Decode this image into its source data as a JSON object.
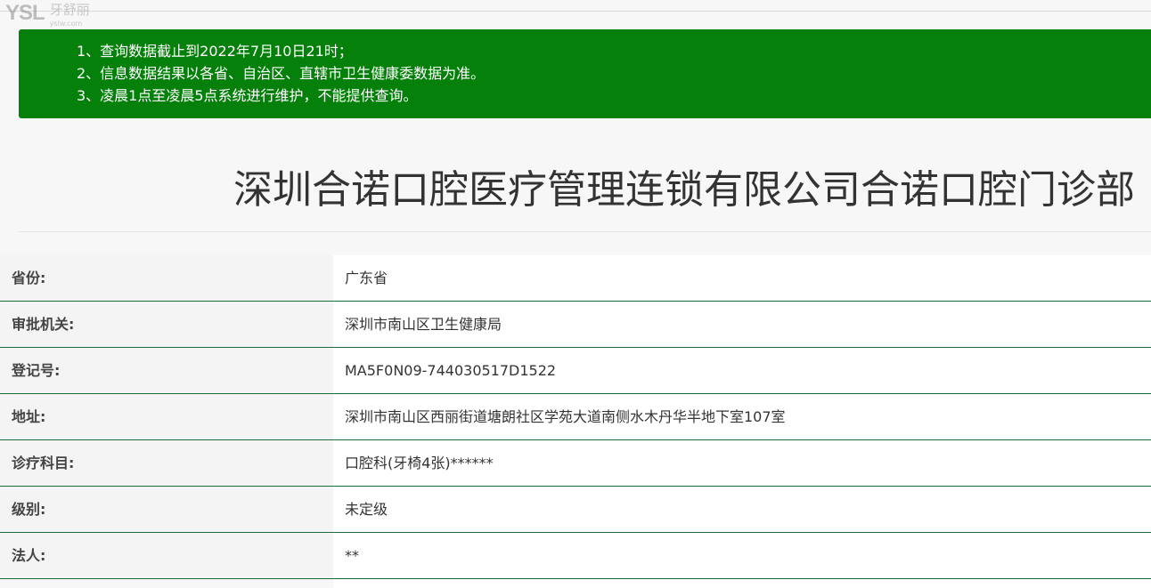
{
  "watermark": {
    "brand": "YSL",
    "name": "牙舒丽",
    "url": "yslw.com"
  },
  "notice": {
    "lines": [
      "1、查询数据截止到2022年7月10日21时；",
      "2、信息数据结果以各省、自治区、直辖市卫生健康委数据为准。",
      "3、凌晨1点至凌晨5点系统进行维护，不能提供查询。"
    ]
  },
  "title": "深圳合诺口腔医疗管理连锁有限公司合诺口腔门诊部",
  "rows": [
    {
      "label": "省份:",
      "value": "广东省"
    },
    {
      "label": "审批机关:",
      "value": "深圳市南山区卫生健康局"
    },
    {
      "label": "登记号:",
      "value": "MA5F0N09-744030517D1522"
    },
    {
      "label": "地址:",
      "value": "深圳市南山区西丽街道塘朗社区学苑大道南侧水木丹华半地下室107室"
    },
    {
      "label": "诊疗科目:",
      "value": "口腔科(牙椅4张)******"
    },
    {
      "label": "级别:",
      "value": "未定级"
    },
    {
      "label": "法人:",
      "value": "**"
    }
  ],
  "colors": {
    "notice_bg": "#05800a",
    "row_border": "#1f6b3a",
    "label_bg": "#f4f4f4",
    "value_bg": "#ffffff"
  }
}
